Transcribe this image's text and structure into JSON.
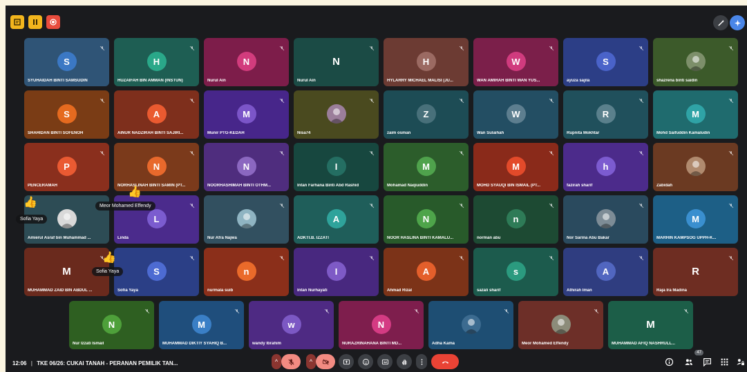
{
  "meeting": {
    "time": "12:06",
    "separator": "|",
    "title": "TKE 06/26: CUKAI TANAH - PERANAN PEMILIK TAN...",
    "participant_count": "47"
  },
  "colors": {
    "page_bg": "#fbf5e1",
    "stage_bg": "#1a1b1e",
    "end_call": "#ea4335",
    "muted_ctrl": "#f28b82"
  },
  "reactions": [
    {
      "name": "Sofia Yaya",
      "emoji": "👍"
    },
    {
      "name": "Meor Mohamed Effendy",
      "emoji": "👍"
    },
    {
      "name": "Sofia Yaya",
      "emoji": "👍"
    }
  ],
  "tiles": [
    {
      "name": "SYUHAIDAH BINTI SAMSUDIN",
      "initial": "S",
      "bg": "#2f5476",
      "av": "#3b78c4",
      "kind": "circle"
    },
    {
      "name": "HUZAIFAH BIN AMMAN (INSTUN)",
      "initial": "H",
      "bg": "#1e5e53",
      "av": "#2aa889",
      "kind": "circle"
    },
    {
      "name": "Nurul Ain",
      "initial": "N",
      "bg": "#7d1d4a",
      "av": "#d23c7d",
      "kind": "circle"
    },
    {
      "name": "Nurul Ain",
      "initial": "N",
      "bg": "#1b4b45",
      "av": "#1b4b45",
      "kind": "plain"
    },
    {
      "name": "HYLARRY MICHAEL MALISI (JU...",
      "initial": "H",
      "bg": "#6c3b33",
      "av": "#9b6a62",
      "kind": "circle"
    },
    {
      "name": "WAN AMIRAH BINTI WAN YUS...",
      "initial": "W",
      "bg": "#7b1f4a",
      "av": "#d03b7e",
      "kind": "circle"
    },
    {
      "name": "ayuza sajila",
      "initial": "S",
      "bg": "#2c3e86",
      "av": "#4a63c9",
      "kind": "circle"
    },
    {
      "name": "shazrena binti saidin",
      "initial": "",
      "bg": "#3c5a2a",
      "av": "#7d8f6a",
      "kind": "photo"
    },
    {
      "name": "SHAHIDAN BINTI SOFENOH",
      "initial": "S",
      "bg": "#7a3c15",
      "av": "#e56a1f",
      "kind": "circle"
    },
    {
      "name": "AINUR NADZIRAH BINTI SAJIRI...",
      "initial": "A",
      "bg": "#7e2f1c",
      "av": "#ea5a30",
      "kind": "circle"
    },
    {
      "name": "Munir PTG-KEDAH",
      "initial": "M",
      "bg": "#47268a",
      "av": "#7b55c8",
      "kind": "circle"
    },
    {
      "name": "Nisa74",
      "initial": "",
      "bg": "#4a4a1f",
      "av": "#9b7e9a",
      "kind": "photo"
    },
    {
      "name": "zaim osman",
      "initial": "Z",
      "bg": "#1d4c55",
      "av": "#48707a",
      "kind": "circle"
    },
    {
      "name": "Wan Sulaihah",
      "initial": "W",
      "bg": "#234e63",
      "av": "#5d7e8f",
      "kind": "circle"
    },
    {
      "name": "Rupnita Mokhtar",
      "initial": "R",
      "bg": "#20505c",
      "av": "#5a808c",
      "kind": "circle"
    },
    {
      "name": "Mohd Saifuddin Kamaludin",
      "initial": "M",
      "bg": "#1f6b6e",
      "av": "#2fa3a6",
      "kind": "circle"
    },
    {
      "name": "PENCERAMAH",
      "initial": "P",
      "bg": "#8a2f1d",
      "av": "#ea5a32",
      "kind": "circle"
    },
    {
      "name": "NORHASLINAH BINTI SAMIN (PT...",
      "initial": "N",
      "bg": "#7b3a1b",
      "av": "#e8692c",
      "kind": "circle"
    },
    {
      "name": "NOORHASHIMAH BINTI OTHM...",
      "initial": "N",
      "bg": "#4f2d7e",
      "av": "#8b67c0",
      "kind": "circle"
    },
    {
      "name": "Intan Farhana Binti Abd Rashid",
      "initial": "I",
      "bg": "#17473f",
      "av": "#246e62",
      "kind": "circle"
    },
    {
      "name": "Mohamad Naqiuddin",
      "initial": "M",
      "bg": "#2c5d2b",
      "av": "#4fa24c",
      "kind": "circle"
    },
    {
      "name": "MOHD SYAUQI BIN ISMAIL (PT...",
      "initial": "M",
      "bg": "#8a2a1a",
      "av": "#e34a2a",
      "kind": "circle"
    },
    {
      "name": "fazirah sharif",
      "initial": "h",
      "bg": "#4c2b8b",
      "av": "#7c5bd0",
      "kind": "circle"
    },
    {
      "name": "Zabidah",
      "initial": "",
      "bg": "#6b3a22",
      "av": "#b08a6e",
      "kind": "photo"
    },
    {
      "name": "Amierul Asraf bin Muhammad ...",
      "initial": "",
      "bg": "#2d4c55",
      "av": "#d9d9d9",
      "kind": "photo"
    },
    {
      "name": "Linda",
      "initial": "L",
      "bg": "#4b2b8c",
      "av": "#7b5ccf",
      "kind": "circle"
    },
    {
      "name": "Nur Afra Najwa",
      "initial": "",
      "bg": "#325060",
      "av": "#8fb4c2",
      "kind": "photo"
    },
    {
      "name": "ADKTI.B. IZZATI",
      "initial": "A",
      "bg": "#1f5e5a",
      "av": "#2fa39b",
      "kind": "circle"
    },
    {
      "name": "NOOR HASLINA BINTI KAMALU...",
      "initial": "N",
      "bg": "#285a2a",
      "av": "#4ea44a",
      "kind": "circle"
    },
    {
      "name": "norman abu",
      "initial": "n",
      "bg": "#1d4a33",
      "av": "#2e7b57",
      "kind": "circle"
    },
    {
      "name": "Nor Sarina Abu Bakar",
      "initial": "",
      "bg": "#2a4a5e",
      "av": "#7d8c96",
      "kind": "photo"
    },
    {
      "name": "MARHIN KAMPSOG UPPH-K...",
      "initial": "M",
      "bg": "#1d5f86",
      "av": "#3a8fcf",
      "kind": "circle"
    },
    {
      "name": "MUHAMMAD ZAID BIN ABDUL ...",
      "initial": "M",
      "bg": "#6a2a1d",
      "av": "#6a2a1d",
      "kind": "plain"
    },
    {
      "name": "Sofia Yaya",
      "initial": "S",
      "bg": "#2b3f86",
      "av": "#4d6bd2",
      "kind": "circle"
    },
    {
      "name": "nurmala suib",
      "initial": "n",
      "bg": "#8b2f1a",
      "av": "#ea6a2a",
      "kind": "circle"
    },
    {
      "name": "Intan Nurhayati",
      "initial": "I",
      "bg": "#48287f",
      "av": "#7e5ac6",
      "kind": "circle"
    },
    {
      "name": "Ahmad Rizal",
      "initial": "A",
      "bg": "#7c3318",
      "av": "#e45f2b",
      "kind": "circle"
    },
    {
      "name": "sazali sharif",
      "initial": "s",
      "bg": "#1c5b4d",
      "av": "#2b9a7f",
      "kind": "circle"
    },
    {
      "name": "Athirah Iman",
      "initial": "A",
      "bg": "#2f3d80",
      "av": "#5166c0",
      "kind": "circle"
    },
    {
      "name": "Raja Ira Madina",
      "initial": "R",
      "bg": "#6e2d22",
      "av": "#6e2d22",
      "kind": "plain"
    },
    {
      "name": "Nur Izzati Ismail",
      "initial": "N",
      "bg": "#2e5f21",
      "av": "#4ea03a",
      "kind": "circle"
    },
    {
      "name": "MUHAMMAD DIKTIY SYAHIQ B...",
      "initial": "M",
      "bg": "#1f4e7c",
      "av": "#3a7fc6",
      "kind": "circle"
    },
    {
      "name": "wandy Ibrahim",
      "initial": "w",
      "bg": "#4e2a83",
      "av": "#7c58c4",
      "kind": "circle"
    },
    {
      "name": "NURAZRINAHANA BINTI MD...",
      "initial": "N",
      "bg": "#7e1e4d",
      "av": "#d43b83",
      "kind": "circle"
    },
    {
      "name": "Adha Kama",
      "initial": "",
      "bg": "#1e4e73",
      "av": "#3c6b90",
      "kind": "photo"
    },
    {
      "name": "Meor Mohamed Effendy",
      "initial": "",
      "bg": "#6d2f28",
      "av": "#8c8c7a",
      "kind": "photo"
    },
    {
      "name": "MUHAMMAD AFIQ NASHRULL...",
      "initial": "M",
      "bg": "#1c5e48",
      "av": "#1c5e48",
      "kind": "plain"
    }
  ]
}
